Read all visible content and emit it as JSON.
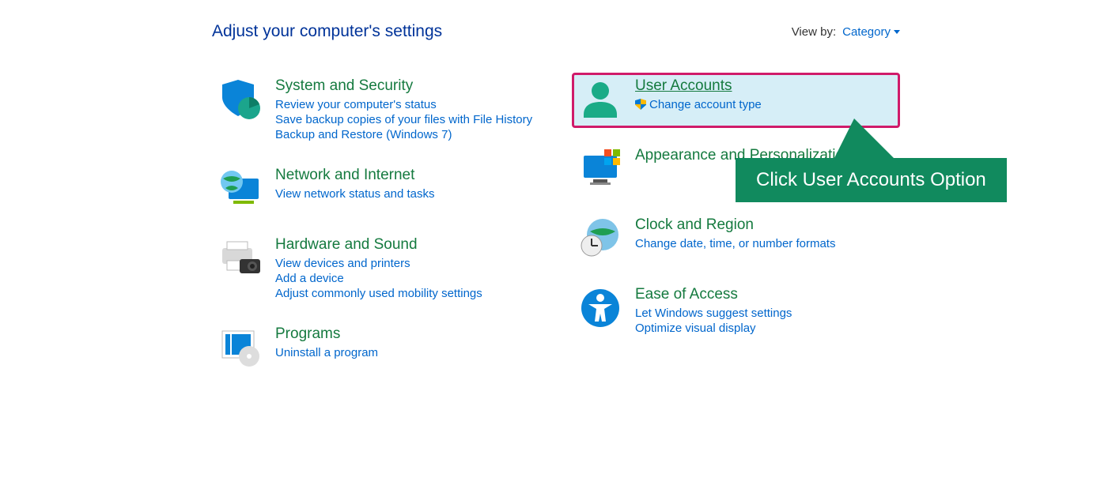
{
  "header": {
    "title": "Adjust your computer's settings",
    "view_by_label": "View by:",
    "view_by_value": "Category"
  },
  "left_column": [
    {
      "id": "system-security",
      "title": "System and Security",
      "links": [
        {
          "label": "Review your computer's status",
          "type": "link"
        },
        {
          "label": "Save backup copies of your files with File History",
          "type": "link"
        },
        {
          "label": "Backup and Restore (Windows 7)",
          "type": "link"
        }
      ],
      "icon": "shield-stats-icon"
    },
    {
      "id": "network-internet",
      "title": "Network and Internet",
      "links": [
        {
          "label": "View network status and tasks",
          "type": "link"
        }
      ],
      "icon": "globe-monitor-icon"
    },
    {
      "id": "hardware-sound",
      "title": "Hardware and Sound",
      "links": [
        {
          "label": "View devices and printers",
          "type": "link"
        },
        {
          "label": "Add a device",
          "type": "link"
        },
        {
          "label": "Adjust commonly used mobility settings",
          "type": "link"
        }
      ],
      "icon": "printer-camera-icon"
    },
    {
      "id": "programs",
      "title": "Programs",
      "links": [
        {
          "label": "Uninstall a program",
          "type": "link"
        }
      ],
      "icon": "window-disc-icon"
    }
  ],
  "right_column": [
    {
      "id": "user-accounts",
      "title": "User Accounts",
      "title_underlined": true,
      "highlighted": true,
      "links": [
        {
          "label": "Change account type",
          "type": "link",
          "shield": true
        }
      ],
      "icon": "user-icon"
    },
    {
      "id": "appearance",
      "title": "Appearance and Personalization",
      "links": [],
      "icon": "monitor-tiles-icon"
    },
    {
      "id": "clock-region",
      "title": "Clock and Region",
      "links": [
        {
          "label": "Change date, time, or number formats",
          "type": "text"
        }
      ],
      "icon": "clock-globe-icon"
    },
    {
      "id": "ease-of-access",
      "title": "Ease of Access",
      "links": [
        {
          "label": "Let Windows suggest settings",
          "type": "link"
        },
        {
          "label": "Optimize visual display",
          "type": "link"
        }
      ],
      "icon": "accessibility-icon"
    }
  ],
  "callout": "Click User Accounts Option"
}
